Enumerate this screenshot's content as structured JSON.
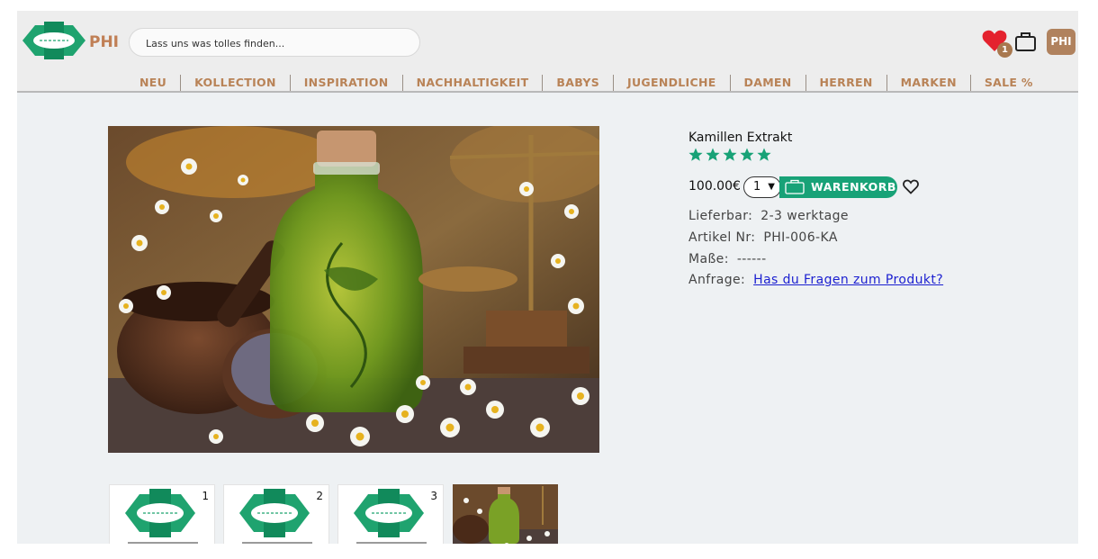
{
  "header": {
    "brand": "PHI",
    "search_placeholder": "Lass uns was tolles finden...",
    "wishlist_count": "1",
    "avatar_label": "PHI"
  },
  "nav": {
    "items": [
      "NEU",
      "KOLLECTION",
      "INSPIRATION",
      "NACHHALTIGKEIT",
      "BABYS",
      "JUGENDLICHE",
      "DAMEN",
      "HERREN",
      "MARKEN",
      "SALE %"
    ]
  },
  "product": {
    "title": "Kamillen Extrakt",
    "rating": 5,
    "price": "100.00€",
    "quantity": "1",
    "cart_label": "WARENKORB",
    "lieferbar_label": "Lieferbar:",
    "lieferbar_value": "2-3 werktage",
    "artikel_label": "Artikel Nr:",
    "artikel_value": "PHI-006-KA",
    "masse_label": "Maße:",
    "masse_value": "------",
    "anfrage_label": "Anfrage:",
    "anfrage_link": "Has du Fragen zum Produkt?"
  },
  "thumbnails": {
    "labels": [
      "1",
      "2",
      "3"
    ]
  },
  "colors": {
    "accent_green": "#18a277",
    "brand_brown": "#b98357",
    "heart_red": "#e4222e"
  }
}
